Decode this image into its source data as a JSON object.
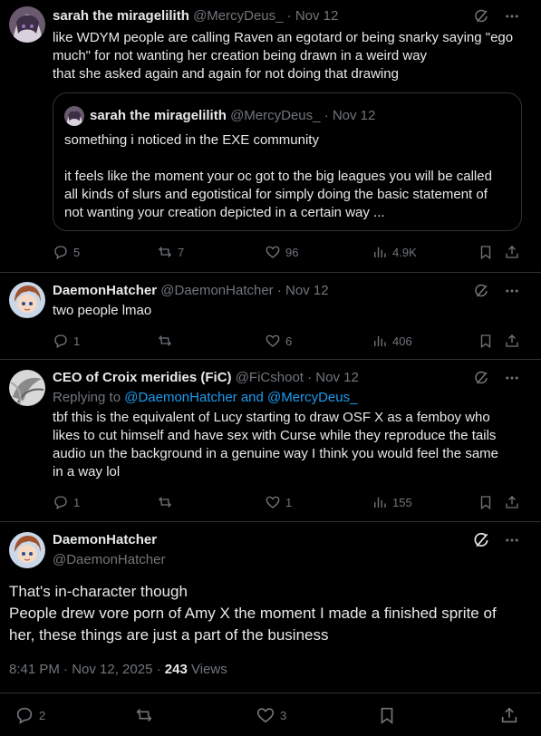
{
  "tweet1": {
    "name": "sarah the miragelilith",
    "handle": "@MercyDeus_",
    "date": "Nov 12",
    "lines": [
      "like WDYM people are calling Raven an egotard or being snarky saying \"ego",
      "much\" for not wanting her creation being drawn in a weird way",
      "that she asked again and again for not doing that drawing"
    ],
    "quote": {
      "name": "sarah the miragelilith",
      "handle": "@MercyDeus_",
      "date": "Nov 12",
      "line1": "something i noticed in the EXE community",
      "lines": [
        "it feels like the moment your oc got to the big leagues you will be called",
        "all kinds of slurs and egotistical for simply doing the basic statement of",
        "not wanting your creation depicted in a certain way ..."
      ]
    },
    "stats": {
      "replies": "5",
      "reposts": "7",
      "likes": "96",
      "views": "4.9K"
    }
  },
  "tweet2": {
    "name": "DaemonHatcher",
    "handle": "@DaemonHatcher",
    "date": "Nov 12",
    "text": "two people lmao",
    "stats": {
      "replies": "1",
      "reposts": "",
      "likes": "6",
      "views": "406"
    }
  },
  "tweet3": {
    "name": "CEO of Croix meridies (FiC)",
    "handle": "@FiCshoot",
    "date": "Nov 12",
    "replying_prefix": "Replying to",
    "replying_users": "@DaemonHatcher and @MercyDeus_",
    "lines": [
      "tbf this is the equivalent of Lucy starting to draw OSF X as a femboy who",
      "likes to cut himself and have sex with Curse while they reproduce the tails",
      "audio un the background in a genuine way I think you would feel the same",
      "in a way lol"
    ],
    "stats": {
      "replies": "1",
      "reposts": "",
      "likes": "1",
      "views": "155"
    }
  },
  "main": {
    "name": "DaemonHatcher",
    "handle": "@DaemonHatcher",
    "lines": [
      "That's in-character though",
      "People drew vore porn of Amy X the moment I made a finished sprite of",
      "her, these things are just a part of the business"
    ],
    "time": "8:41 PM · Nov 12, 2025 ·",
    "views_count": "243",
    "views_label": "Views",
    "stats": {
      "replies": "2",
      "reposts": "",
      "likes": "3"
    }
  },
  "separator": "·",
  "colors": {
    "bg": "#000000",
    "text": "#e7e9ea",
    "muted": "#71767b",
    "link": "#1d9bf0",
    "border": "#2f3336"
  }
}
